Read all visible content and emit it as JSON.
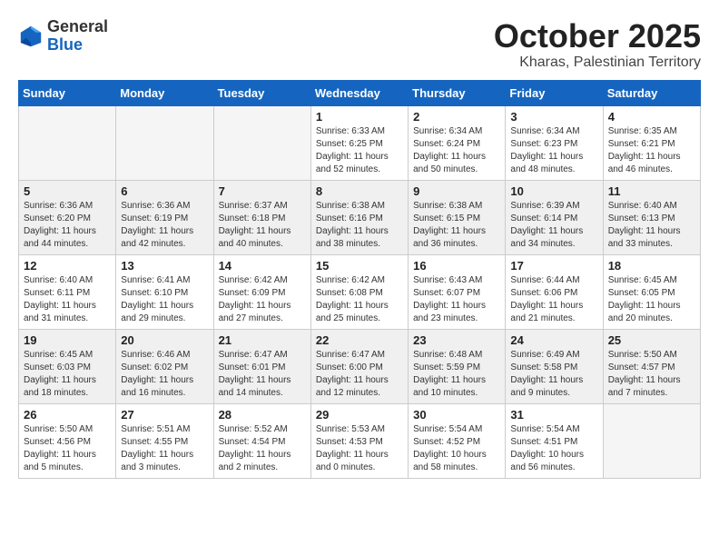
{
  "header": {
    "logo_general": "General",
    "logo_blue": "Blue",
    "month_year": "October 2025",
    "location": "Kharas, Palestinian Territory"
  },
  "days_of_week": [
    "Sunday",
    "Monday",
    "Tuesday",
    "Wednesday",
    "Thursday",
    "Friday",
    "Saturday"
  ],
  "weeks": [
    {
      "shaded": false,
      "days": [
        {
          "num": "",
          "lines": []
        },
        {
          "num": "",
          "lines": []
        },
        {
          "num": "",
          "lines": []
        },
        {
          "num": "1",
          "lines": [
            "Sunrise: 6:33 AM",
            "Sunset: 6:25 PM",
            "Daylight: 11 hours",
            "and 52 minutes."
          ]
        },
        {
          "num": "2",
          "lines": [
            "Sunrise: 6:34 AM",
            "Sunset: 6:24 PM",
            "Daylight: 11 hours",
            "and 50 minutes."
          ]
        },
        {
          "num": "3",
          "lines": [
            "Sunrise: 6:34 AM",
            "Sunset: 6:23 PM",
            "Daylight: 11 hours",
            "and 48 minutes."
          ]
        },
        {
          "num": "4",
          "lines": [
            "Sunrise: 6:35 AM",
            "Sunset: 6:21 PM",
            "Daylight: 11 hours",
            "and 46 minutes."
          ]
        }
      ]
    },
    {
      "shaded": true,
      "days": [
        {
          "num": "5",
          "lines": [
            "Sunrise: 6:36 AM",
            "Sunset: 6:20 PM",
            "Daylight: 11 hours",
            "and 44 minutes."
          ]
        },
        {
          "num": "6",
          "lines": [
            "Sunrise: 6:36 AM",
            "Sunset: 6:19 PM",
            "Daylight: 11 hours",
            "and 42 minutes."
          ]
        },
        {
          "num": "7",
          "lines": [
            "Sunrise: 6:37 AM",
            "Sunset: 6:18 PM",
            "Daylight: 11 hours",
            "and 40 minutes."
          ]
        },
        {
          "num": "8",
          "lines": [
            "Sunrise: 6:38 AM",
            "Sunset: 6:16 PM",
            "Daylight: 11 hours",
            "and 38 minutes."
          ]
        },
        {
          "num": "9",
          "lines": [
            "Sunrise: 6:38 AM",
            "Sunset: 6:15 PM",
            "Daylight: 11 hours",
            "and 36 minutes."
          ]
        },
        {
          "num": "10",
          "lines": [
            "Sunrise: 6:39 AM",
            "Sunset: 6:14 PM",
            "Daylight: 11 hours",
            "and 34 minutes."
          ]
        },
        {
          "num": "11",
          "lines": [
            "Sunrise: 6:40 AM",
            "Sunset: 6:13 PM",
            "Daylight: 11 hours",
            "and 33 minutes."
          ]
        }
      ]
    },
    {
      "shaded": false,
      "days": [
        {
          "num": "12",
          "lines": [
            "Sunrise: 6:40 AM",
            "Sunset: 6:11 PM",
            "Daylight: 11 hours",
            "and 31 minutes."
          ]
        },
        {
          "num": "13",
          "lines": [
            "Sunrise: 6:41 AM",
            "Sunset: 6:10 PM",
            "Daylight: 11 hours",
            "and 29 minutes."
          ]
        },
        {
          "num": "14",
          "lines": [
            "Sunrise: 6:42 AM",
            "Sunset: 6:09 PM",
            "Daylight: 11 hours",
            "and 27 minutes."
          ]
        },
        {
          "num": "15",
          "lines": [
            "Sunrise: 6:42 AM",
            "Sunset: 6:08 PM",
            "Daylight: 11 hours",
            "and 25 minutes."
          ]
        },
        {
          "num": "16",
          "lines": [
            "Sunrise: 6:43 AM",
            "Sunset: 6:07 PM",
            "Daylight: 11 hours",
            "and 23 minutes."
          ]
        },
        {
          "num": "17",
          "lines": [
            "Sunrise: 6:44 AM",
            "Sunset: 6:06 PM",
            "Daylight: 11 hours",
            "and 21 minutes."
          ]
        },
        {
          "num": "18",
          "lines": [
            "Sunrise: 6:45 AM",
            "Sunset: 6:05 PM",
            "Daylight: 11 hours",
            "and 20 minutes."
          ]
        }
      ]
    },
    {
      "shaded": true,
      "days": [
        {
          "num": "19",
          "lines": [
            "Sunrise: 6:45 AM",
            "Sunset: 6:03 PM",
            "Daylight: 11 hours",
            "and 18 minutes."
          ]
        },
        {
          "num": "20",
          "lines": [
            "Sunrise: 6:46 AM",
            "Sunset: 6:02 PM",
            "Daylight: 11 hours",
            "and 16 minutes."
          ]
        },
        {
          "num": "21",
          "lines": [
            "Sunrise: 6:47 AM",
            "Sunset: 6:01 PM",
            "Daylight: 11 hours",
            "and 14 minutes."
          ]
        },
        {
          "num": "22",
          "lines": [
            "Sunrise: 6:47 AM",
            "Sunset: 6:00 PM",
            "Daylight: 11 hours",
            "and 12 minutes."
          ]
        },
        {
          "num": "23",
          "lines": [
            "Sunrise: 6:48 AM",
            "Sunset: 5:59 PM",
            "Daylight: 11 hours",
            "and 10 minutes."
          ]
        },
        {
          "num": "24",
          "lines": [
            "Sunrise: 6:49 AM",
            "Sunset: 5:58 PM",
            "Daylight: 11 hours",
            "and 9 minutes."
          ]
        },
        {
          "num": "25",
          "lines": [
            "Sunrise: 5:50 AM",
            "Sunset: 4:57 PM",
            "Daylight: 11 hours",
            "and 7 minutes."
          ]
        }
      ]
    },
    {
      "shaded": false,
      "days": [
        {
          "num": "26",
          "lines": [
            "Sunrise: 5:50 AM",
            "Sunset: 4:56 PM",
            "Daylight: 11 hours",
            "and 5 minutes."
          ]
        },
        {
          "num": "27",
          "lines": [
            "Sunrise: 5:51 AM",
            "Sunset: 4:55 PM",
            "Daylight: 11 hours",
            "and 3 minutes."
          ]
        },
        {
          "num": "28",
          "lines": [
            "Sunrise: 5:52 AM",
            "Sunset: 4:54 PM",
            "Daylight: 11 hours",
            "and 2 minutes."
          ]
        },
        {
          "num": "29",
          "lines": [
            "Sunrise: 5:53 AM",
            "Sunset: 4:53 PM",
            "Daylight: 11 hours",
            "and 0 minutes."
          ]
        },
        {
          "num": "30",
          "lines": [
            "Sunrise: 5:54 AM",
            "Sunset: 4:52 PM",
            "Daylight: 10 hours",
            "and 58 minutes."
          ]
        },
        {
          "num": "31",
          "lines": [
            "Sunrise: 5:54 AM",
            "Sunset: 4:51 PM",
            "Daylight: 10 hours",
            "and 56 minutes."
          ]
        },
        {
          "num": "",
          "lines": []
        }
      ]
    }
  ]
}
